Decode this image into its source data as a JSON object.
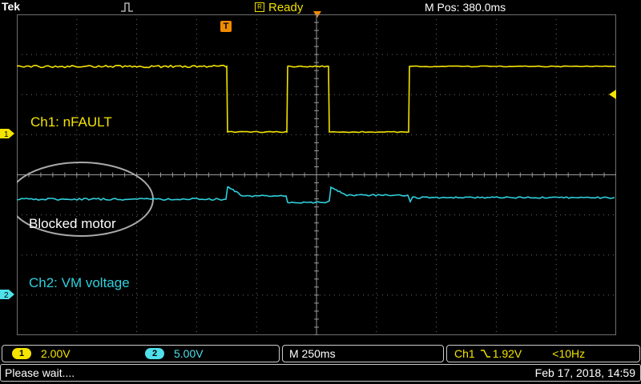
{
  "header": {
    "brand": "Tek",
    "trigger_mode_icon": "pulse-edge-icon",
    "status_icon_text": "R",
    "status": "Ready",
    "m_pos": "M Pos: 380.0ms"
  },
  "screen": {
    "trigger_marker": "T",
    "annotations": {
      "ch1": "Ch1: nFAULT",
      "blocked": "Blocked motor",
      "ch2": "Ch2: VM voltage"
    },
    "channel_markers": {
      "ch1": "1",
      "ch2": "2"
    }
  },
  "bottom": {
    "ch1_badge": "1",
    "ch1_scale": "2.00V",
    "ch2_badge": "2",
    "ch2_scale": "5.00V",
    "timebase": "M 250ms",
    "trigger_source": "Ch1",
    "trigger_slope_icon": "falling-edge-icon",
    "trigger_level": "1.92V",
    "trigger_freq": "<10Hz"
  },
  "message": {
    "text": "Please wait....",
    "datetime": "Feb 17, 2018, 14:59"
  },
  "colors": {
    "ch1": "#f4e400",
    "ch2": "#2ed0dc",
    "trigger": "#f08a00",
    "grid": "#7a7a7a"
  }
}
